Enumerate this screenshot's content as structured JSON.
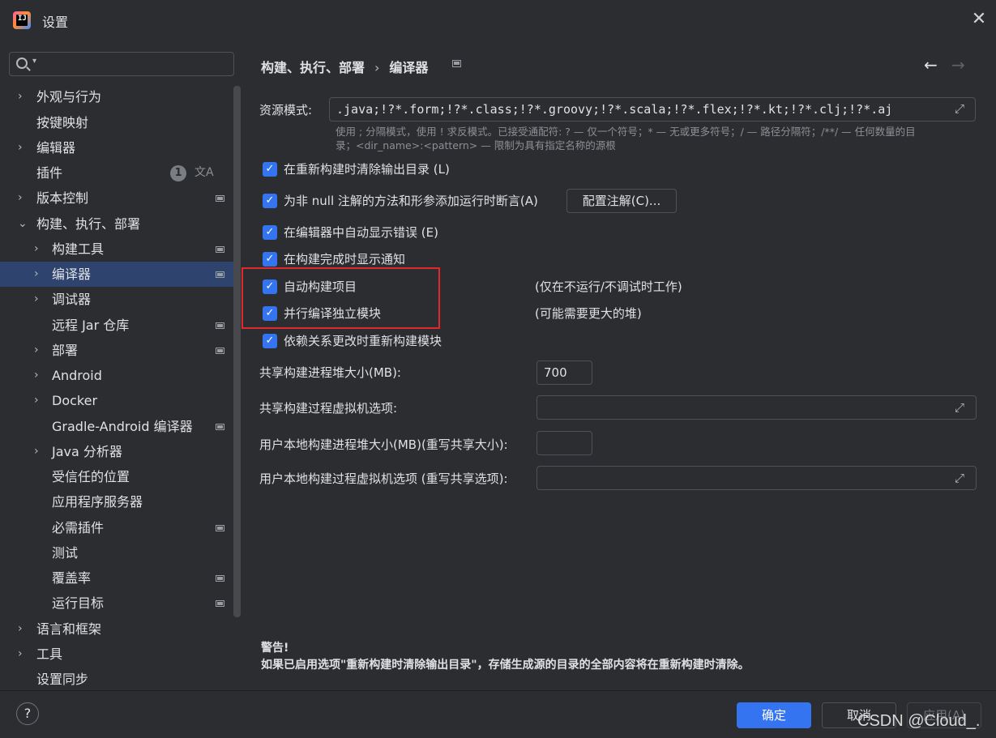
{
  "window": {
    "title": "设置"
  },
  "search": {
    "placeholder": ""
  },
  "sidebar": {
    "items": [
      {
        "label": "外观与行为"
      },
      {
        "label": "按键映射"
      },
      {
        "label": "编辑器"
      },
      {
        "label": "插件",
        "badge": "1"
      },
      {
        "label": "版本控制"
      },
      {
        "label": "构建、执行、部署"
      },
      {
        "label": "构建工具"
      },
      {
        "label": "编译器"
      },
      {
        "label": "调试器"
      },
      {
        "label": "远程 Jar 仓库"
      },
      {
        "label": "部署"
      },
      {
        "label": "Android"
      },
      {
        "label": "Docker"
      },
      {
        "label": "Gradle-Android 编译器"
      },
      {
        "label": "Java 分析器"
      },
      {
        "label": "受信任的位置"
      },
      {
        "label": "应用程序服务器"
      },
      {
        "label": "必需插件"
      },
      {
        "label": "测试"
      },
      {
        "label": "覆盖率"
      },
      {
        "label": "运行目标"
      },
      {
        "label": "语言和框架"
      },
      {
        "label": "工具"
      },
      {
        "label": "设置同步"
      }
    ]
  },
  "main": {
    "breadcrumb": {
      "parent": "构建、执行、部署",
      "separator": "›",
      "current": "编译器"
    },
    "resource_patterns": {
      "label": "资源模式:",
      "value": ".java;!?*.form;!?*.class;!?*.groovy;!?*.scala;!?*.flex;!?*.kt;!?*.clj;!?*.aj",
      "hint_line1": "使用 ; 分隔模式，使用 ! 求反模式。已接受通配符: ? — 仅一个符号；* — 无或更多符号；/ — 路径分隔符；/**/ — 任何数量的目",
      "hint_line2": "录；<dir_name>:<pattern> — 限制为具有指定名称的源根"
    },
    "checkboxes": [
      {
        "label": "在重新构建时清除输出目录 (L)",
        "checked": true
      },
      {
        "label": "为非 null 注解的方法和形参添加运行时断言(A)",
        "checked": true
      },
      {
        "label": "在编辑器中自动显示错误 (E)",
        "checked": true
      },
      {
        "label": "在构建完成时显示通知",
        "checked": true
      },
      {
        "label": "自动构建项目",
        "checked": true
      },
      {
        "label": "并行编译独立模块",
        "checked": true
      },
      {
        "label": "依赖关系更改时重新构建模块",
        "checked": true
      }
    ],
    "configure_annotations_button": "配置注解(C)...",
    "notes": {
      "auto_build": "(仅在不运行/不调试时工作)",
      "parallel": "(可能需要更大的堆)"
    },
    "fields": {
      "shared_heap_label": "共享构建进程堆大小(MB):",
      "shared_heap_value": "700",
      "shared_vm_label": "共享构建过程虚拟机选项:",
      "shared_vm_value": "",
      "user_heap_label": "用户本地构建进程堆大小(MB)(重写共享大小):",
      "user_heap_value": "",
      "user_vm_label": "用户本地构建过程虚拟机选项 (重写共享选项):",
      "user_vm_value": ""
    },
    "warning": {
      "title": "警告!",
      "text": "如果已启用选项\"重新构建时清除输出目录\"，存储生成源的目录的全部内容将在重新构建时清除。"
    }
  },
  "footer": {
    "help": "?",
    "ok": "确定",
    "cancel": "取消",
    "apply": "应用(A)",
    "watermark": "CSDN @Cloud_."
  },
  "colors": {
    "background": "#2b2d30",
    "accent": "#3574f0",
    "selection": "#2e436e",
    "highlight_box": "#e0282e"
  }
}
